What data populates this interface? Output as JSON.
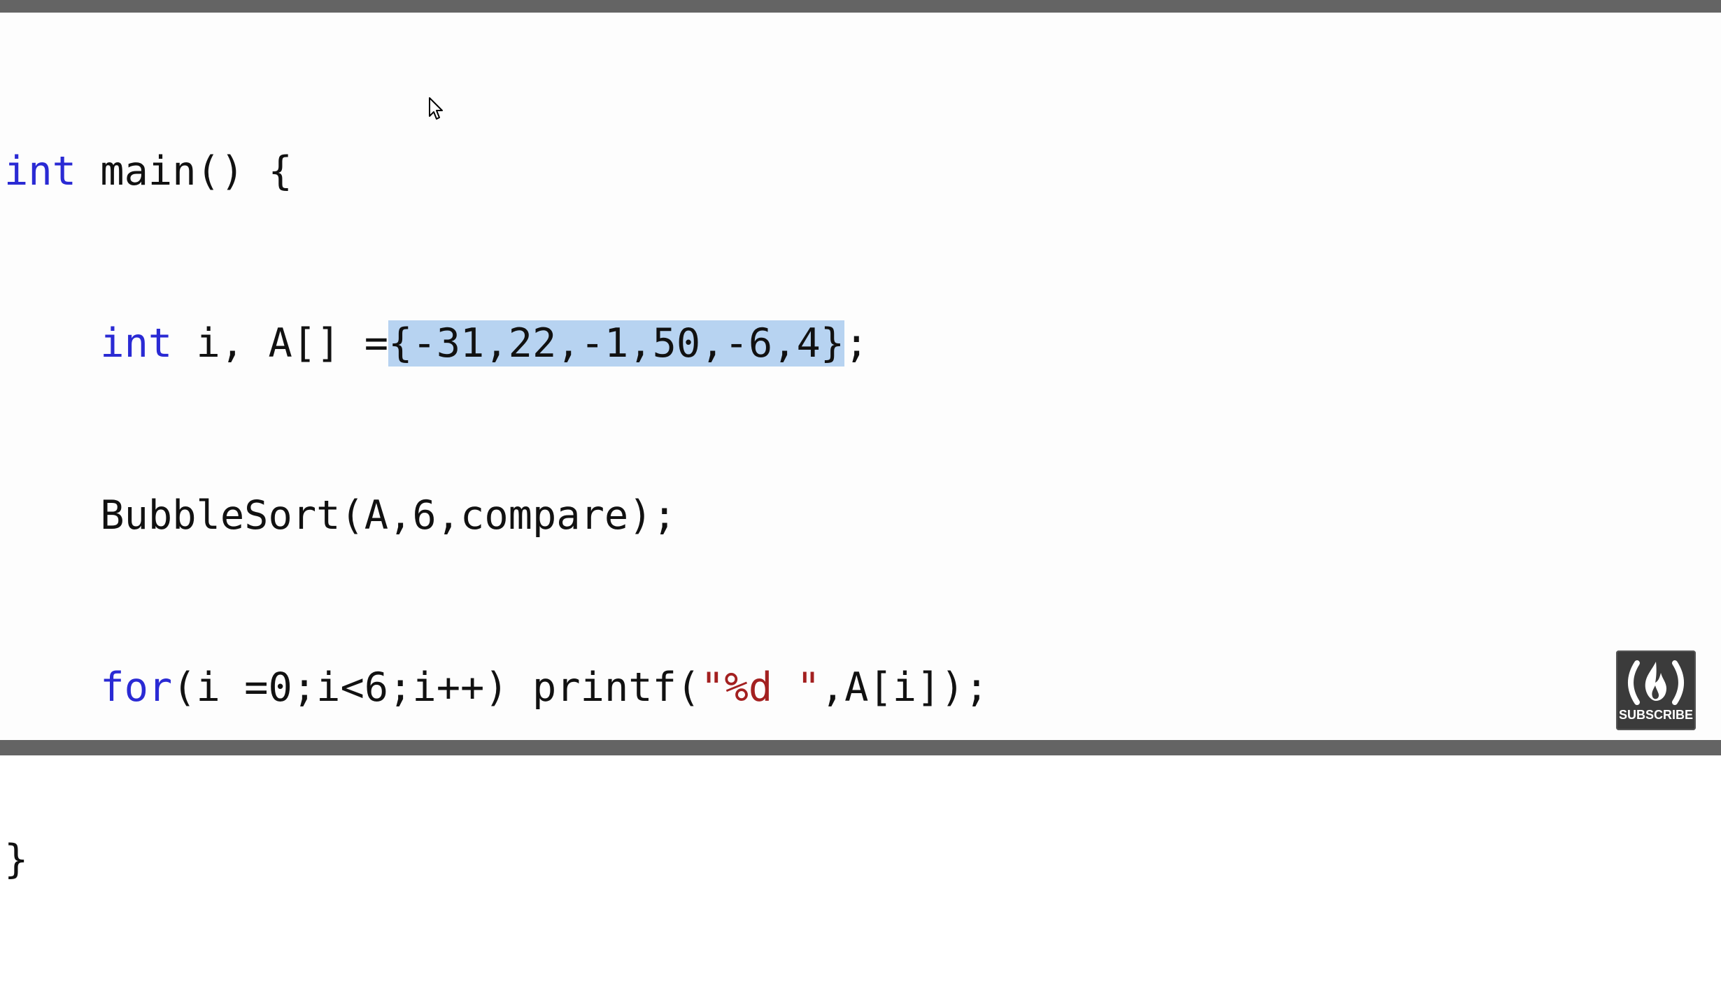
{
  "code": {
    "line1": {
      "kw": "int",
      "rest": " main() {"
    },
    "line2": {
      "indent": "    ",
      "kw": "int",
      "before_sel": " i, A[] =",
      "selected": "{-31,22,-1,50,-6,4}",
      "after_sel": ";"
    },
    "line3": {
      "indent": "    ",
      "text": "BubbleSort(A,6,compare);"
    },
    "line4": {
      "indent": "    ",
      "kw": "for",
      "mid": "(i =0;i<6;i++) printf(",
      "str": "\"%d \"",
      "end": ",A[i]);"
    },
    "line5": {
      "text": "}"
    }
  },
  "badge": {
    "label": "SUBSCRIBE",
    "icon": "freecodecamp-flame-icon"
  },
  "colors": {
    "keyword": "#2a2ad4",
    "string": "#a32020",
    "selection": "#b7d3f1",
    "bar": "#646464"
  }
}
